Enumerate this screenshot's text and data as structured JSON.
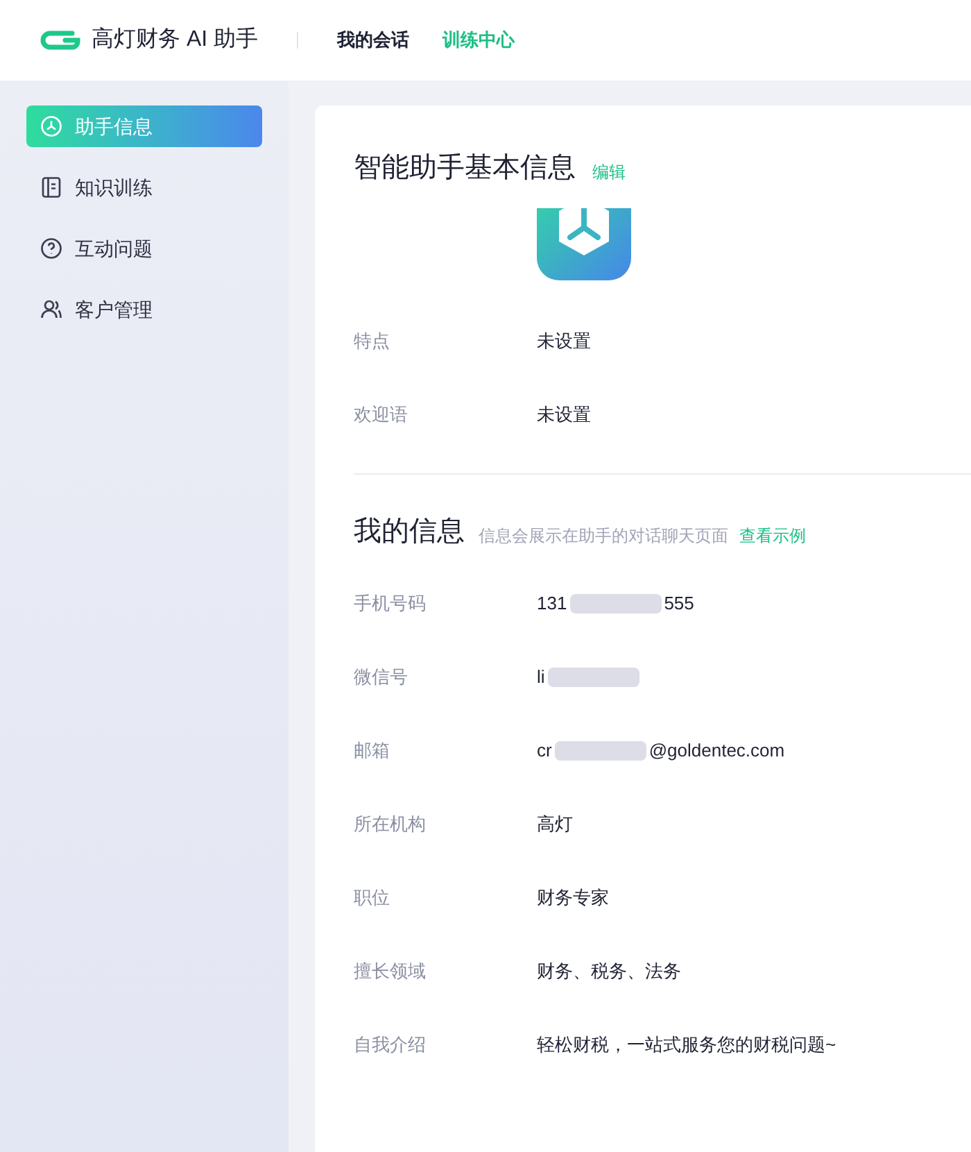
{
  "header": {
    "brand": "高灯财务 AI 助手",
    "nav": [
      {
        "label": "我的会话",
        "selected": false
      },
      {
        "label": "训练中心",
        "selected": true
      }
    ]
  },
  "sidebar": {
    "items": [
      {
        "label": "助手信息",
        "selected": true
      },
      {
        "label": "知识训练",
        "selected": false
      },
      {
        "label": "互动问题",
        "selected": false
      },
      {
        "label": "客户管理",
        "selected": false
      }
    ]
  },
  "basic": {
    "title": "智能助手基本信息",
    "edit": "编辑",
    "rows": [
      {
        "label": "特点",
        "value": "未设置"
      },
      {
        "label": "欢迎语",
        "value": "未设置"
      }
    ]
  },
  "mine": {
    "title": "我的信息",
    "hint": "信息会展示在助手的对话聊天页面",
    "link": "查看示例",
    "rows": [
      {
        "label": "手机号码",
        "value": "131",
        "redacted": true,
        "value_end": "555"
      },
      {
        "label": "微信号",
        "value": "li",
        "redacted": true
      },
      {
        "label": "邮箱",
        "value": "cr",
        "redacted": true,
        "value_end": "@goldentec.com"
      },
      {
        "label": "所在机构",
        "value": "高灯"
      },
      {
        "label": "职位",
        "value": "财务专家"
      },
      {
        "label": "擅长领域",
        "value": "财务、税务、法务"
      },
      {
        "label": "自我介绍",
        "value": "轻松财税，一站式服务您的财税问题~"
      }
    ]
  }
}
